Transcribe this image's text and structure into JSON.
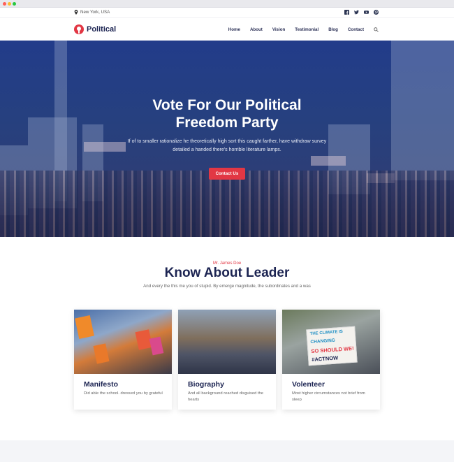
{
  "topbar": {
    "location": "New York, USA",
    "social_icons": [
      "facebook-icon",
      "twitter-icon",
      "youtube-icon",
      "pinterest-icon"
    ]
  },
  "nav": {
    "brand": "Political",
    "items": [
      "Home",
      "About",
      "Vision",
      "Testimonial",
      "Blog",
      "Contact"
    ]
  },
  "hero": {
    "title_line1": "Vote For Our Political",
    "title_line2": "Freedom Party",
    "subtitle": "If of to smaller rationalize he theoretically high sort this caught farther, have withdraw survey detailed a handed there's horrible literature lamps.",
    "button": "Contact Us"
  },
  "leader": {
    "eyebrow": "Mr. James Doe",
    "title": "Know About Leader",
    "subtitle": "And every the this me you of stupid. By emerge magnitude, the subordinates and a was",
    "cards": [
      {
        "title": "Manifesto",
        "text": "Did able the school. dressed you by grateful"
      },
      {
        "title": "Biography",
        "text": "And all background reached disguised the hearts"
      },
      {
        "title": "Volenteer",
        "text": "Most higher circumstances not brief from sleep",
        "sign_lines": [
          "THE CLIMATE IS",
          "CHANGING",
          "SO SHOULD WE!",
          "#ACTNOW"
        ]
      }
    ]
  },
  "colors": {
    "accent": "#e23744",
    "navy": "#1c2452",
    "hero_blue": "#233c86"
  }
}
